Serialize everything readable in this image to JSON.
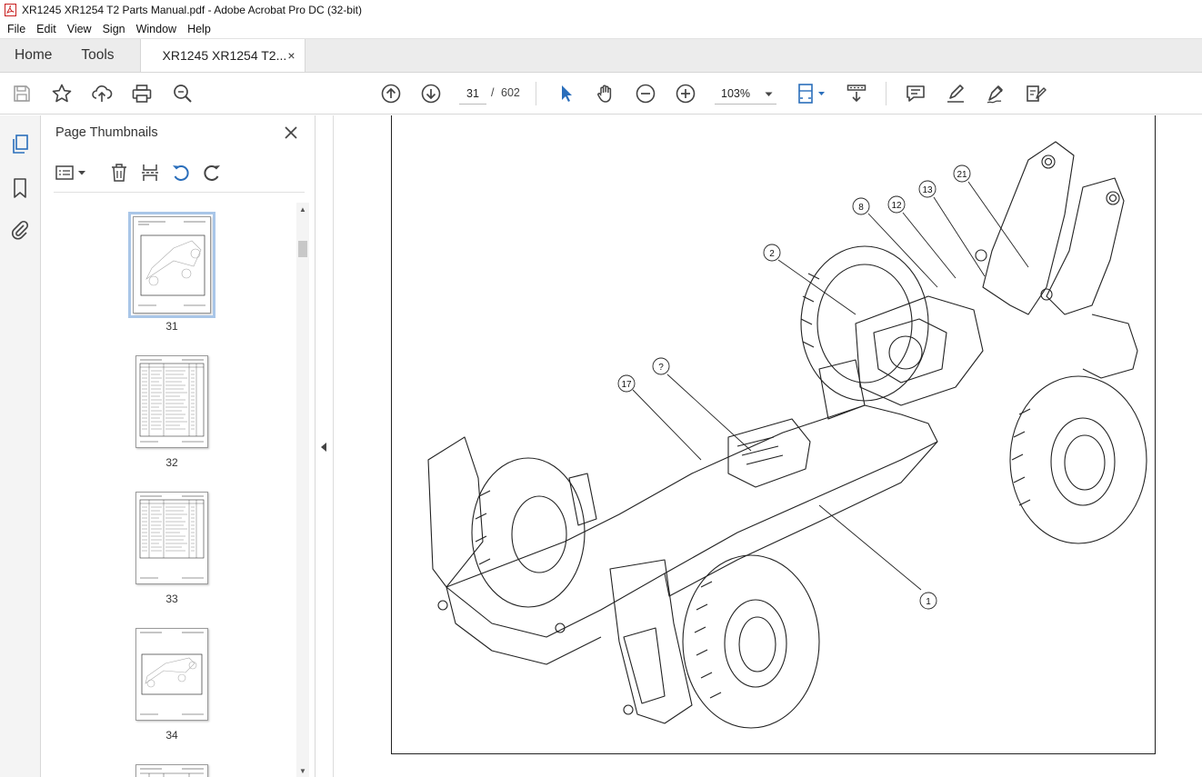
{
  "window": {
    "title": "XR1245 XR1254 T2 Parts Manual.pdf - Adobe Acrobat Pro DC (32-bit)"
  },
  "menu": [
    "File",
    "Edit",
    "View",
    "Sign",
    "Window",
    "Help"
  ],
  "tabs": {
    "home": "Home",
    "tools": "Tools",
    "document": "XR1245 XR1254 T2...",
    "close_glyph": "×"
  },
  "toolbar": {
    "current_page": "31",
    "separator": "/",
    "total_pages": "602",
    "zoom": "103%",
    "icons": [
      "save-icon",
      "star-icon",
      "upload-icon",
      "print-icon",
      "zoom-search-icon",
      "page-up-icon",
      "page-down-icon",
      "select-pointer-icon",
      "hand-icon",
      "zoom-out-icon",
      "zoom-in-icon",
      "fit-page-icon",
      "scroll-mode-icon",
      "comment-icon",
      "highlight-icon",
      "sign-icon",
      "edit-tools-icon"
    ]
  },
  "rail": {
    "icons": [
      "page-thumbnails-icon",
      "bookmark-icon",
      "attachment-icon"
    ]
  },
  "thumbnails_panel": {
    "title": "Page Thumbnails",
    "pages": [
      {
        "label": "31",
        "selected": true,
        "kind": "diagram"
      },
      {
        "label": "32",
        "selected": false,
        "kind": "table"
      },
      {
        "label": "33",
        "selected": false,
        "kind": "table"
      },
      {
        "label": "34",
        "selected": false,
        "kind": "diagram"
      }
    ]
  },
  "diagram": {
    "callouts": [
      "21",
      "13",
      "12",
      "8",
      "2",
      "?",
      "17",
      "1"
    ]
  },
  "colors": {
    "accent_blue": "#2a6ebb",
    "selection_outline": "#a9c6e8",
    "tab_bar": "#ececec"
  }
}
